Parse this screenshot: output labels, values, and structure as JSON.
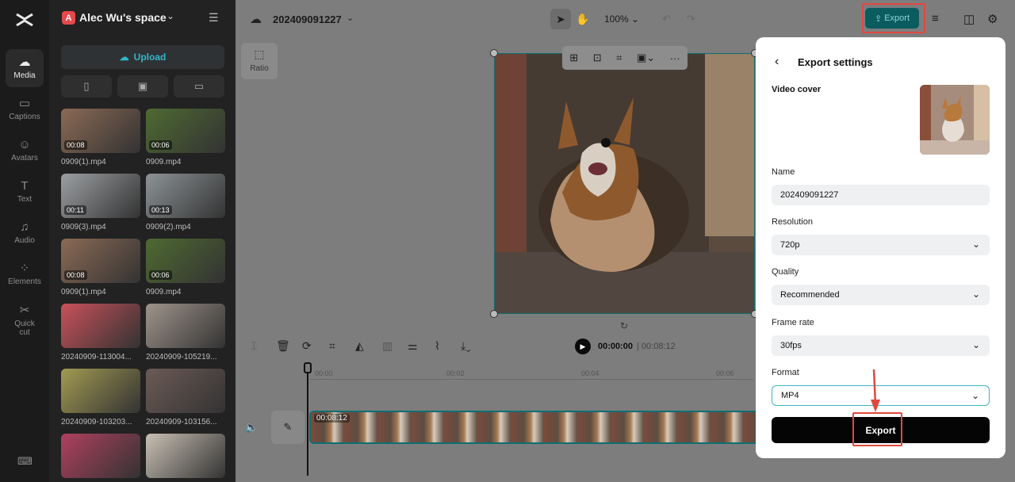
{
  "rail": {
    "items": [
      {
        "label": "Media",
        "icon": "media-icon"
      },
      {
        "label": "Captions",
        "icon": "captions-icon"
      },
      {
        "label": "Avatars",
        "icon": "avatars-icon"
      },
      {
        "label": "Text",
        "icon": "text-icon"
      },
      {
        "label": "Audio",
        "icon": "audio-icon"
      },
      {
        "label": "Elements",
        "icon": "elements-icon"
      },
      {
        "label": "Quick\ncut",
        "icon": "quick-cut-icon"
      }
    ]
  },
  "media_panel": {
    "space_initial": "A",
    "space_name": "Alec Wu's space",
    "upload_label": "Upload",
    "files": [
      {
        "name": "0909(1).mp4",
        "duration": "00:08",
        "color": "#8b6a55"
      },
      {
        "name": "0909.mp4",
        "duration": "00:06",
        "color": "#4e6a32"
      },
      {
        "name": "0909(3).mp4",
        "duration": "00:11",
        "color": "#9c9fa2"
      },
      {
        "name": "0909(2).mp4",
        "duration": "00:13",
        "color": "#8d9396"
      },
      {
        "name": "0909(1).mp4",
        "duration": "00:08",
        "color": "#8b6a55"
      },
      {
        "name": "0909.mp4",
        "duration": "00:06",
        "color": "#4e6a32"
      },
      {
        "name": "20240909-113004...",
        "duration": "",
        "color": "#c8515a"
      },
      {
        "name": "20240909-105219...",
        "duration": "",
        "color": "#9f948b"
      },
      {
        "name": "20240909-103203...",
        "duration": "",
        "color": "#a29a52"
      },
      {
        "name": "20240909-103156...",
        "duration": "",
        "color": "#6c5a55"
      },
      {
        "name": "",
        "duration": "",
        "color": "#b0405e"
      },
      {
        "name": "",
        "duration": "",
        "color": "#c8c0b3"
      }
    ]
  },
  "topbar": {
    "project_name": "202409091227",
    "zoom": "100%",
    "export_label": "Export"
  },
  "canvas": {
    "ratio_label": "Ratio"
  },
  "timeline": {
    "current_time": "00:00:00",
    "total_time": "00:08:12",
    "ruler": [
      "00:00",
      "00:02",
      "00:04",
      "00:06"
    ],
    "clip_duration": "00:08:12"
  },
  "export_settings": {
    "title": "Export settings",
    "video_cover_label": "Video cover",
    "name_label": "Name",
    "name_value": "202409091227",
    "resolution_label": "Resolution",
    "resolution_value": "720p",
    "quality_label": "Quality",
    "quality_value": "Recommended",
    "frame_rate_label": "Frame rate",
    "frame_rate_value": "30fps",
    "format_label": "Format",
    "format_value": "MP4",
    "export_button": "Export"
  },
  "colors": {
    "accent": "#2fb7c9",
    "highlight": "#e0483f",
    "export_dark": "#0b5c5f"
  }
}
